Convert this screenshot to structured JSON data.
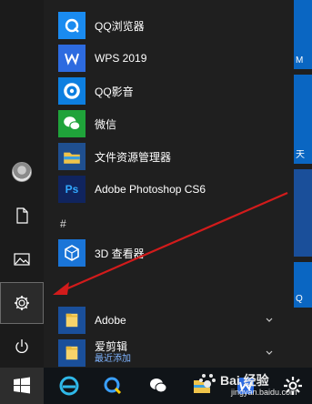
{
  "start_menu": {
    "rail": {
      "items": [
        {
          "name": "user-account"
        },
        {
          "name": "documents"
        },
        {
          "name": "pictures"
        },
        {
          "name": "settings"
        },
        {
          "name": "power"
        }
      ]
    },
    "apps": [
      {
        "label": "QQ浏览器",
        "icon": "qq-browser-icon",
        "color": "#1a8bf0"
      },
      {
        "label": "WPS 2019",
        "icon": "wps-icon",
        "color": "#2d6be0"
      },
      {
        "label": "QQ影音",
        "icon": "qq-player-icon",
        "color": "#0d7fe0"
      },
      {
        "label": "微信",
        "icon": "wechat-icon",
        "color": "#1fa33a"
      },
      {
        "label": "文件资源管理器",
        "icon": "file-explorer-icon",
        "color": "#f0c44a"
      },
      {
        "label": "Adobe Photoshop CS6",
        "icon": "photoshop-icon",
        "color": "#10245e"
      }
    ],
    "section_hash": "#",
    "apps_hash": [
      {
        "label": "3D 查看器",
        "icon": "3d-viewer-icon",
        "color": "#1a75d8"
      }
    ],
    "folders": [
      {
        "label": "Adobe",
        "sublabel": ""
      },
      {
        "label": "爱剪辑",
        "sublabel": "最近添加"
      }
    ]
  },
  "tiles_right": [
    {
      "label": "M",
      "color": "#0a66c2"
    },
    {
      "label": "天",
      "color": "#0a66c2"
    },
    {
      "label": "Q",
      "color": "#0a66c2"
    }
  ],
  "taskbar": {
    "items": [
      {
        "name": "start-button"
      },
      {
        "name": "edge-icon"
      },
      {
        "name": "qq-browser-icon"
      },
      {
        "name": "wechat-icon"
      },
      {
        "name": "file-explorer-icon"
      },
      {
        "name": "wps-icon"
      },
      {
        "name": "settings-icon"
      }
    ]
  },
  "watermark": {
    "brand": "Bai 经验",
    "url": "jingyan.baidu.com"
  }
}
